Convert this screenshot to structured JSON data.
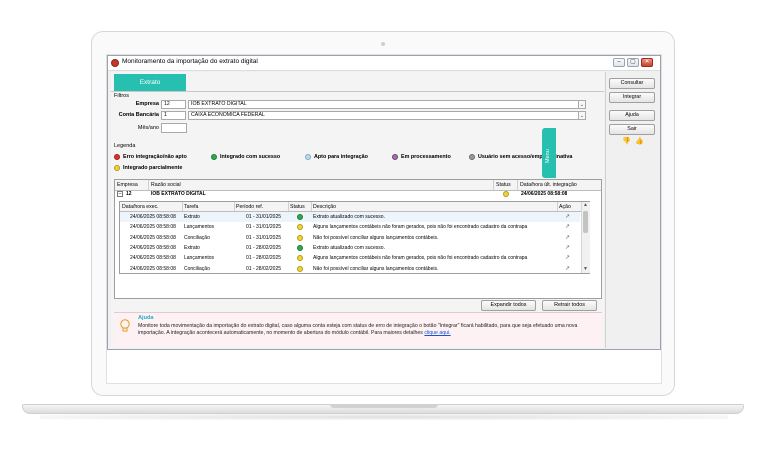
{
  "window": {
    "title": "Monitoramento da importação do extrato digital",
    "min": "–",
    "max": "▢",
    "close": "✕"
  },
  "tab": {
    "label": "Extrato"
  },
  "filters": {
    "section": "Filtros",
    "empresa_label": "Empresa",
    "empresa_code": "12",
    "empresa_name": "IOB EXTRATO DIGITAL",
    "conta_label": "Conta Bancária",
    "conta_code": "1",
    "conta_name": "CAIXA ECONOMICA FEDERAL",
    "mesano_label": "Mês/ano",
    "mesano_value": ""
  },
  "legend": {
    "section": "Legenda",
    "items": [
      {
        "label": "Erro integração/não apto",
        "color": "#d9342b"
      },
      {
        "label": "Integrado com sucesso",
        "color": "#2fa84f"
      },
      {
        "label": "Apto para integração",
        "color": "#b9dbea"
      },
      {
        "label": "Em processamento",
        "color": "#a070a8"
      },
      {
        "label": "Usuário sem acesso/empresa inativa",
        "color": "#9a9a9a"
      },
      {
        "label": "Integrado parcialmente",
        "color": "#f0d23c"
      }
    ]
  },
  "company_grid": {
    "headers": {
      "empresa": "Empresa",
      "razao": "Razão social",
      "status": "Status",
      "data": "Data/hora últ. integração"
    },
    "row": {
      "toggle": "–",
      "code": "12",
      "name": "IOB EXTRATO DIGITAL",
      "status_color": "#f0d23c",
      "datetime": "24/06/2025 08:58:08"
    }
  },
  "task_grid": {
    "headers": {
      "data": "Data/hora exec.",
      "tarefa": "Tarefa",
      "periodo": "Período ref.",
      "status": "Status",
      "descricao": "Descrição",
      "acao": "Ação"
    },
    "rows": [
      {
        "data": "24/06/2025 08:58:08",
        "tarefa": "Extrato",
        "periodo": "01 - 31/01/2025",
        "status": "#2fa84f",
        "descricao": "Extrato atualizado com sucesso."
      },
      {
        "data": "24/06/2025 08:58:08",
        "tarefa": "Lançamentos",
        "periodo": "01 - 31/01/2025",
        "status": "#f0d23c",
        "descricao": "Alguns lançamentos contábeis não foram gerados, pois não foi encontrado cadastro da contrapa"
      },
      {
        "data": "24/06/2025 08:58:08",
        "tarefa": "Conciliação",
        "periodo": "01 - 31/01/2025",
        "status": "#f0d23c",
        "descricao": "Não foi possível conciliar alguns lançamentos contábeis."
      },
      {
        "data": "24/06/2025 08:58:08",
        "tarefa": "Extrato",
        "periodo": "01 - 28/02/2025",
        "status": "#2fa84f",
        "descricao": "Extrato atualizado com sucesso."
      },
      {
        "data": "24/06/2025 08:58:08",
        "tarefa": "Lançamentos",
        "periodo": "01 - 28/02/2025",
        "status": "#f0d23c",
        "descricao": "Alguns lançamentos contábeis não foram gerados, pois não foi encontrado cadastro da contrapa"
      },
      {
        "data": "24/06/2025 08:58:08",
        "tarefa": "Conciliação",
        "periodo": "01 - 28/02/2025",
        "status": "#f0d23c",
        "descricao": "Não foi possível conciliar alguns lançamentos contábeis."
      }
    ],
    "action_icon": "↗"
  },
  "buttons": {
    "expandir": "Expandir todos",
    "retrair": "Retrair todos"
  },
  "side": {
    "consultar": "Consultar",
    "integrar": "Integrar",
    "ajuda": "Ajuda",
    "sair": "Sair",
    "thumbs_down": "👎",
    "thumbs_up": "👍"
  },
  "menu_tab": "Menu",
  "help": {
    "title": "Ajuda",
    "text": "Monitore toda movimentação da importação do extrato digital, caso alguma conta esteja com status de erro de integração o botão \"Integrar\" ficará habilitado, para que seja efetuado uma nova importação. A integração acontecerá automaticamente, no momento de abertura do módulo contábil. Para maiores detalhes",
    "link": "clique aqui."
  },
  "colors": {
    "accent": "#27bfb0",
    "error": "#d9342b",
    "success": "#2fa84f",
    "partial": "#f0d23c"
  }
}
